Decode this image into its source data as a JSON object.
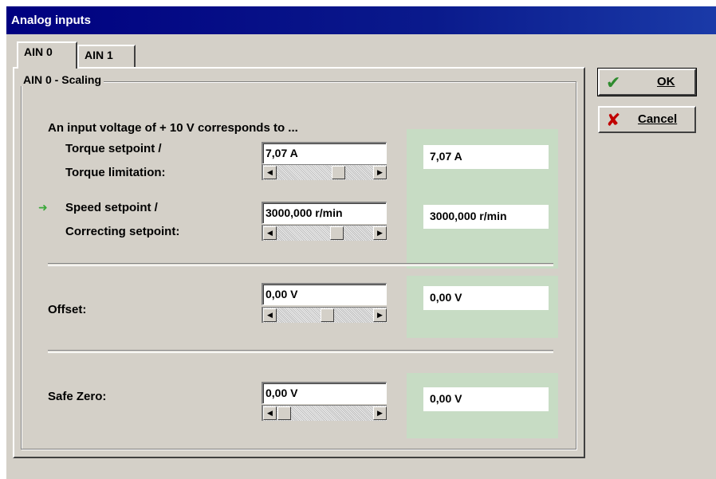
{
  "window": {
    "title": "Analog inputs"
  },
  "tabs": [
    {
      "label": "AIN 0",
      "active": true
    },
    {
      "label": "AIN 1",
      "active": false
    }
  ],
  "group": {
    "legend": "AIN 0 - Scaling"
  },
  "intro": "An input voltage of + 10 V corresponds to ...",
  "torque": {
    "label_1": "Torque setpoint /",
    "label_2": "Torque limitation:",
    "value": "7,07 A",
    "readout": "7,07 A"
  },
  "speed": {
    "label_1": "Speed setpoint /",
    "label_2": "Correcting setpoint:",
    "value": "3000,000 r/min",
    "readout": "3000,000 r/min",
    "marker_icon": "green-arrow-icon"
  },
  "offset": {
    "label": "Offset:",
    "value": "0,00 V",
    "readout": "0,00 V"
  },
  "safe_zero": {
    "label": "Safe Zero:",
    "value": "0,00 V",
    "readout": "0,00 V"
  },
  "buttons": {
    "ok": {
      "label": "OK",
      "icon": "checkmark-icon",
      "color": "#2e8b2e"
    },
    "cancel": {
      "label": "Cancel",
      "icon": "cross-icon",
      "color": "#c00000"
    }
  },
  "colors": {
    "titlebar": "#000080",
    "readout_panel": "#c7dcc4",
    "dialog": "#d4d0c8"
  }
}
